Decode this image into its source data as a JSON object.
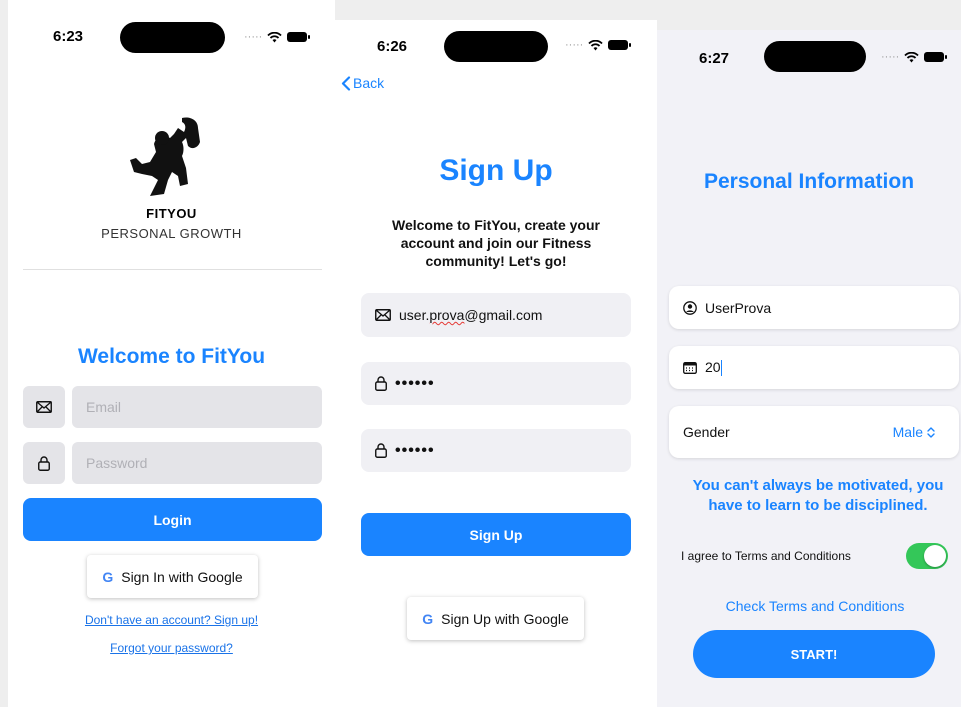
{
  "screen1": {
    "time": "6:23",
    "brand_name": "FITYOU",
    "brand_tagline": "PERSONAL GROWTH",
    "welcome": "Welcome to FitYou",
    "email_placeholder": "Email",
    "password_placeholder": "Password",
    "login_label": "Login",
    "google_label": "Sign In with Google",
    "signup_link": "Don't have an account? Sign up!",
    "forgot_link": "Forgot your password?"
  },
  "screen2": {
    "time": "6:26",
    "back_label": "Back",
    "title": "Sign Up",
    "description": "Welcome to FitYou, create your account and join our Fitness community! Let's go!",
    "email_prefix": "user.",
    "email_misspelled": "prova",
    "email_suffix": "@gmail.com",
    "password_dots": "••••••",
    "confirm_password_dots": "••••••",
    "signup_label": "Sign Up",
    "google_label": "Sign Up with Google"
  },
  "screen3": {
    "time": "6:27",
    "title": "Personal Information",
    "username": "UserProva",
    "age": "20",
    "gender_label": "Gender",
    "gender_value": "Male",
    "quote": "You can't always be motivated, you have to learn to be disciplined.",
    "terms_label": "I agree to Terms and Conditions",
    "terms_agreed": true,
    "check_terms_link": "Check Terms and Conditions",
    "start_label": "START!"
  },
  "colors": {
    "accent": "#1a84ff",
    "toggle_on": "#34c759",
    "field_gray": "#e4e4e8",
    "google_blue": "#4285f4"
  },
  "icons": [
    "envelope-icon",
    "lock-icon",
    "google-logo-icon",
    "chevron-left-icon",
    "person-circle-icon",
    "calendar-icon",
    "updown-chevron-icon",
    "wifi-icon",
    "battery-icon",
    "bodybuilder-logo"
  ]
}
